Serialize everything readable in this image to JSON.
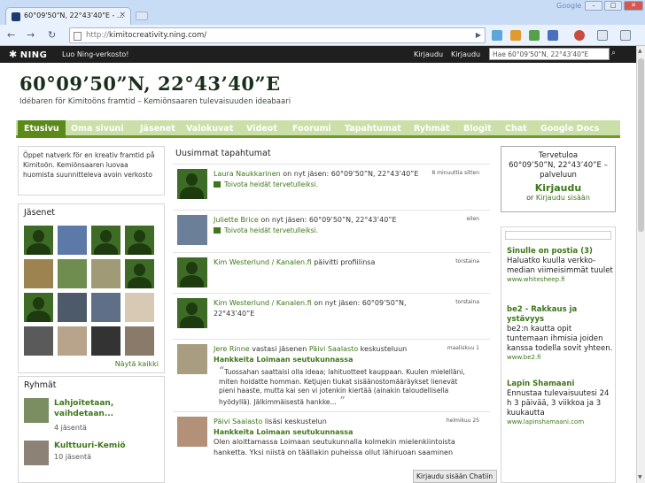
{
  "browser": {
    "tab_title": "60°09'50\"N, 22°43'40\"E - ...",
    "google_label": "Google",
    "url_prefix": "http://",
    "url_host": "kimitocreativity.ning.com/"
  },
  "ning_bar": {
    "logo": "NING",
    "create_link": "Luo Ning-verkosto!",
    "signin_1": "Kirjaudu",
    "signin_2": "Kirjaudu",
    "search_placeholder": "Hae 60°09'50\"N, 22°43'40\"E"
  },
  "site": {
    "title": "60°09’50”N, 22°43’40”E",
    "subtitle": "Idébaren för Kimitoöns framtid – Kemiönsaaren tulevaisuuden ideabaari"
  },
  "nav": [
    "Etusivu",
    "Oma sivuni",
    "Jäsenet",
    "Valokuvat",
    "Videot",
    "Foorumi",
    "Tapahtumat",
    "Ryhmät",
    "Blogit",
    "Chat",
    "Google Docs"
  ],
  "about_text": "Öppet natverk för en kreativ framtid på Kimitoön. Kemiönsaaren luovaa huomista suunnitteleva avoin verkosto",
  "members": {
    "heading": "Jäsenet",
    "show_all": "Näytä kaikki"
  },
  "groups": {
    "heading": "Ryhmät",
    "items": [
      {
        "name": "Lahjoitetaan, vaihdetaan...",
        "count": "4 jäsentä"
      },
      {
        "name": "Kulttuuri-Kemiö",
        "count": "10 jäsentä"
      }
    ]
  },
  "activity": {
    "heading": "Uusimmat tapahtumat",
    "welcome_label": "Toivota heidät tervetulleiksi.",
    "items": [
      {
        "who": "Laura Naukkarinen",
        "action": " on nyt jäsen: 60°09’50”N, 22°43’40”E",
        "when": "8 minuuttia sitten"
      },
      {
        "who": "Juliette Brice",
        "action": " on nyt jäsen: 60°09’50”N, 22°43’40”E",
        "when": "eilen"
      },
      {
        "who": "Kim Westerlund / Kanalen.fi",
        "action": " päivitti profiilinsa",
        "when": "torstaina"
      },
      {
        "who": "Kim Westerlund / Kanalen.fi",
        "action": " on nyt jäsen: 60°09’50”N, 22°43’40”E",
        "when": "torstaina"
      },
      {
        "who": "Jere Rinne",
        "mid": " vastasi jäsenen ",
        "who2": "Päivi Saalasto",
        "action": " keskusteluun",
        "topic": "Hankkeita Loimaan seutukunnassa",
        "quote": "Tuossahan saattaisi olla ideaa; lahituotteet kauppaan. Kuulen mielelläni, miten hoidatte homman. Ketjujen tiukat sisäänostomääräykset lienevät pieni haaste, mutta kai sen vi jotenkin kiertää (ainakin taloudellisella hyödyllä). Jälkimmäisestä hankke...",
        "when": "maaliskuu 1"
      },
      {
        "who": "Päivi Saalasto",
        "action": " lisäsi keskustelun",
        "topic": "Hankkeita Loimaan seutukunnassa",
        "quote": "Olen aloittamassa Loimaan seutukunnalla kolmekin mielenkiintoista hanketta. Yksi niistä on täällakin puheissa ollut lähiruoan saaminen",
        "when": "helmikuu 25"
      }
    ]
  },
  "welcome_box": {
    "line1": "Tervetuloa",
    "line2": "60°09’50”N, 22°43’40”E –",
    "line3": "palveluun",
    "join": "Kirjaudu",
    "or": "or ",
    "signin": "Kirjaudu sisään"
  },
  "blog_list": [
    {
      "title": "Sinulle on postia (3)",
      "desc": "Haluatko kuulla verkko- median viimeisimmät tuulet",
      "url": "www.whitesheep.fi"
    },
    {
      "title": "be2 - Rakkaus ja ystävyys",
      "desc": "be2:n kautta opit tuntemaan ihmisia joiden kanssa todella sovit yhteen.",
      "url": "www.be2.fi"
    },
    {
      "title": "Lapin Shamaani",
      "desc": "Ennustaa tulevaisuutesi 24 h 3 päivää, 3 viikkoa ja 3 kuukautta",
      "url": "www.lapinshamaani.com"
    }
  ],
  "chat_status": "Kirjaudu sisään Chatiin"
}
